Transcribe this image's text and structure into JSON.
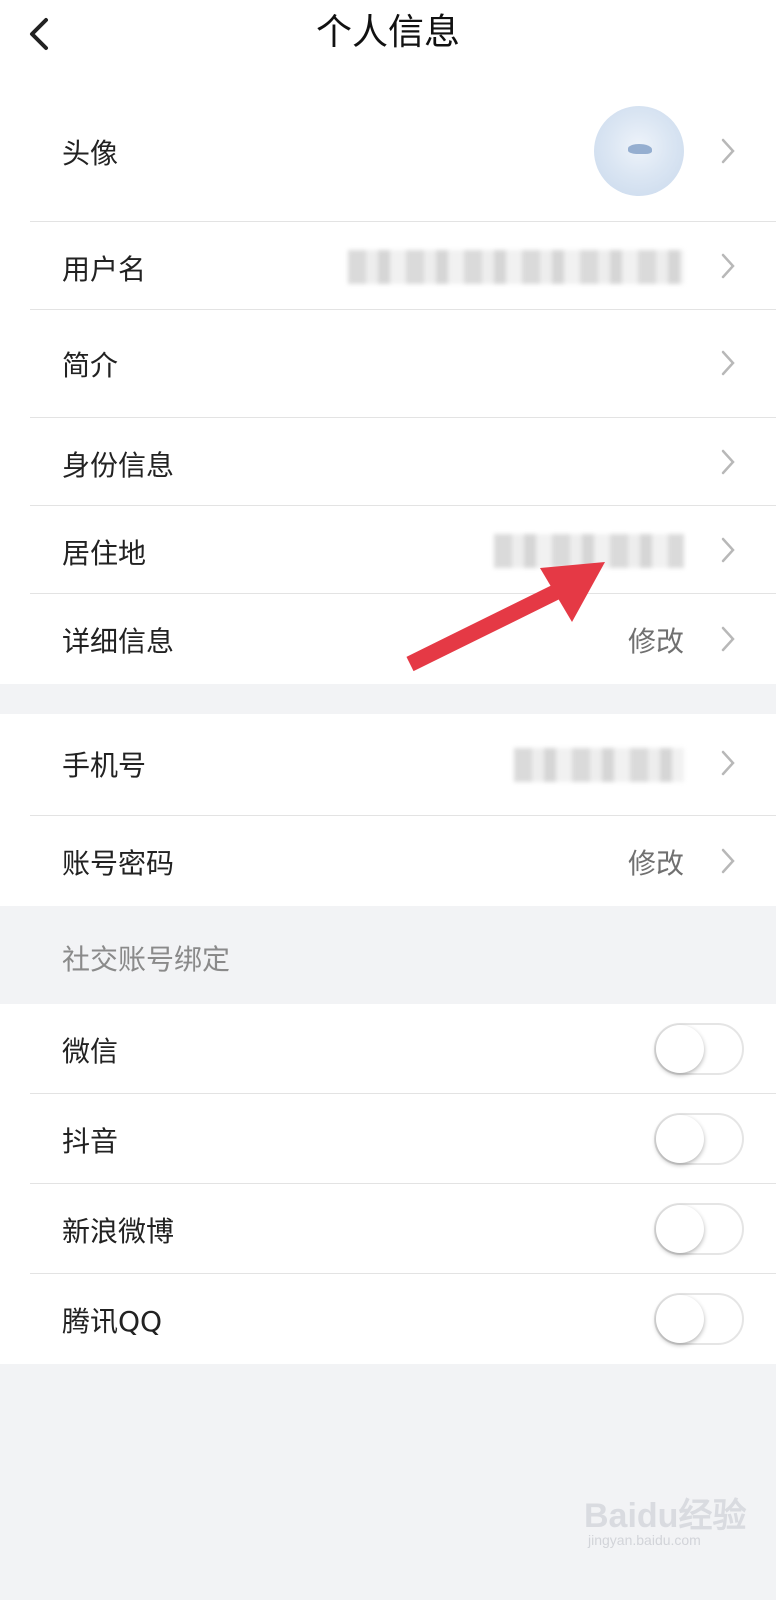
{
  "header": {
    "title": "个人信息"
  },
  "profile_rows": [
    {
      "label": "头像",
      "kind": "avatar"
    },
    {
      "label": "用户名",
      "kind": "blurred"
    },
    {
      "label": "简介",
      "kind": "empty"
    },
    {
      "label": "身份信息",
      "kind": "empty"
    },
    {
      "label": "居住地",
      "kind": "blurred"
    },
    {
      "label": "详细信息",
      "kind": "text",
      "value": "修改"
    }
  ],
  "account_rows": [
    {
      "label": "手机号",
      "kind": "blurred"
    },
    {
      "label": "账号密码",
      "kind": "text",
      "value": "修改"
    }
  ],
  "social": {
    "section_title": "社交账号绑定",
    "items": [
      {
        "label": "微信",
        "enabled": false
      },
      {
        "label": "抖音",
        "enabled": false
      },
      {
        "label": "新浪微博",
        "enabled": false
      },
      {
        "label": "腾讯QQ",
        "enabled": false
      }
    ]
  },
  "watermark": {
    "brand": "Baidu经验",
    "url": "jingyan.baidu.com"
  },
  "colors": {
    "annotation_arrow": "#e53945",
    "page_bg": "#f2f3f5"
  },
  "icons": [
    "back-chevron-icon",
    "chevron-right-icon",
    "toggle-switch"
  ]
}
